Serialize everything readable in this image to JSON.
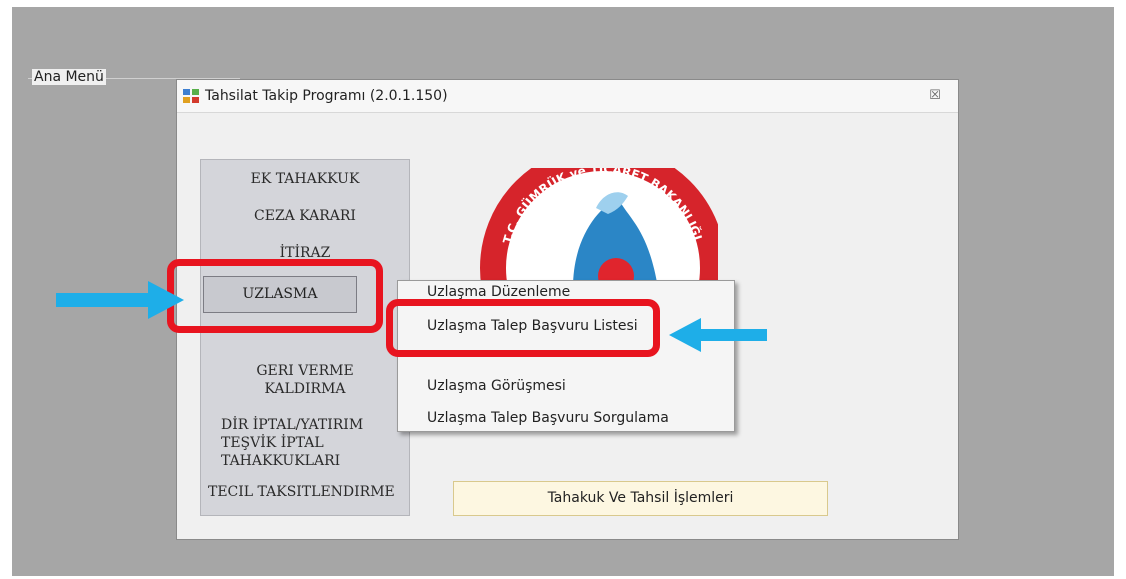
{
  "window": {
    "title": "Tahsilat Takip Programı (2.0.1.150)",
    "close_glyph": "☒"
  },
  "main_menu": {
    "group_label": "Ana Menü",
    "items": [
      {
        "label": "EK TAHAKKUK"
      },
      {
        "label": "CEZA KARARI"
      },
      {
        "label": "İTİRAZ"
      },
      {
        "label": "UZLASMA"
      },
      {
        "label": "GERI VERME"
      },
      {
        "label": "KALDIRMA"
      },
      {
        "label": "DİR İPTAL/YATIRIM"
      },
      {
        "label": "TEŞVİK İPTAL"
      },
      {
        "label": "TAHAKKUKLARI"
      },
      {
        "label": "TECIL TAKSITLENDIRME"
      }
    ]
  },
  "logo": {
    "text": "T.C. GÜMRÜK ve TİCARET BAKANLIĞI"
  },
  "popup_menu": {
    "items": [
      {
        "label": "Uzlaşma Düzenleme"
      },
      {
        "label": "Uzlaşma Talep Başvuru Listesi"
      },
      {
        "label": "Uzlaşma Görüşmesi"
      },
      {
        "label": "Uzlaşma Talep Başvuru Sorgulama"
      }
    ]
  },
  "bottom_button": {
    "label": "Tahakuk Ve Tahsil İşlemleri"
  },
  "colors": {
    "highlight_red": "#e8141f",
    "arrow_blue": "#1eaee8",
    "backdrop": "#a6a6a6"
  }
}
